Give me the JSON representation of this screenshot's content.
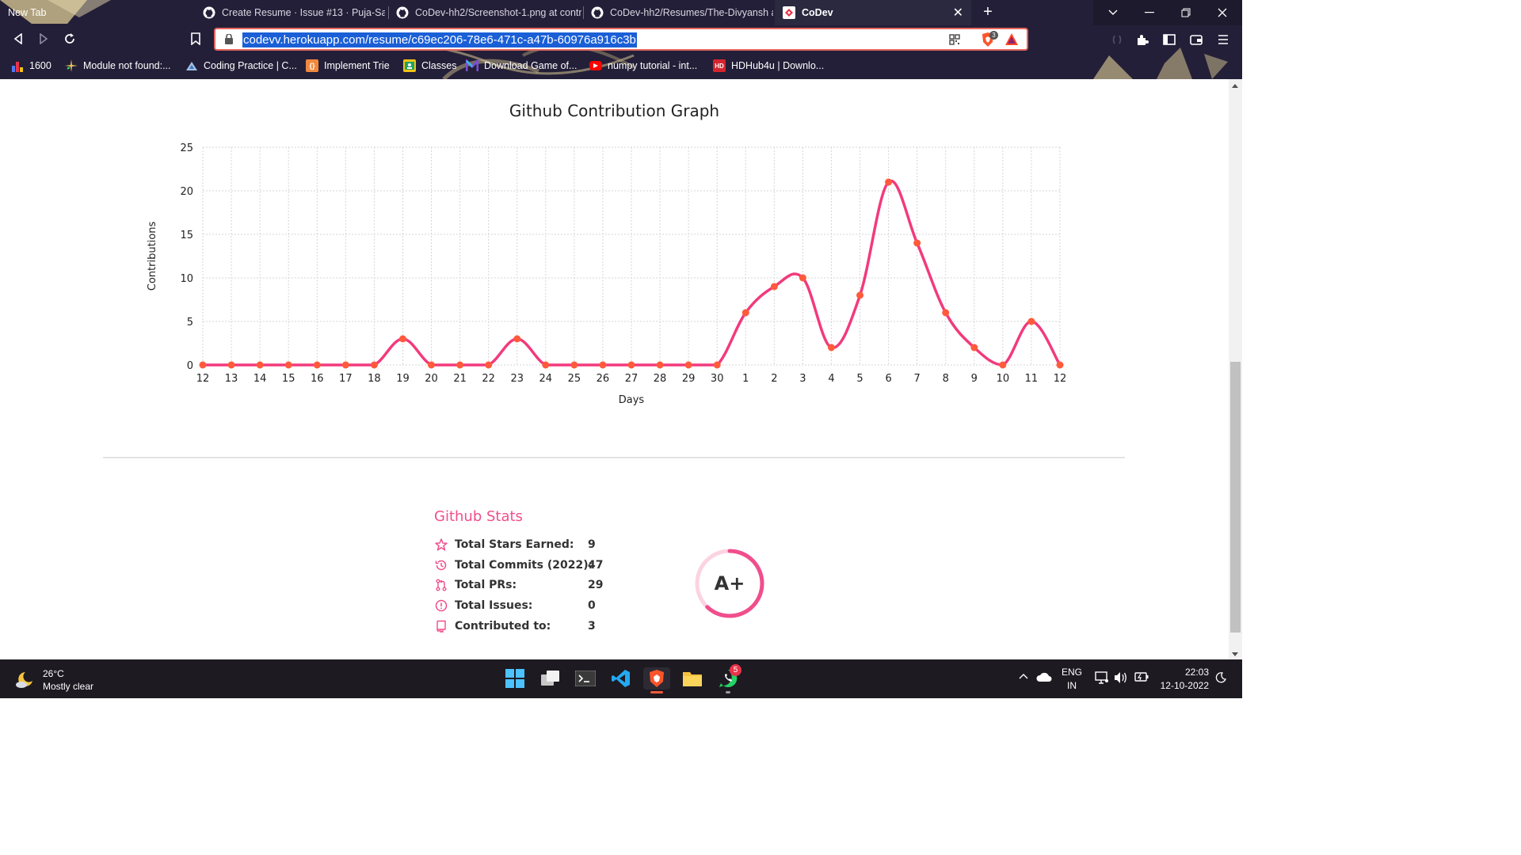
{
  "browser": {
    "tabs": [
      {
        "title": "New Tab"
      },
      {
        "title": "Create Resume · Issue #13 · Puja-Sam"
      },
      {
        "title": "CoDev-hh2/Screenshot-1.png at contr"
      },
      {
        "title": "CoDev-hh2/Resumes/The-Divyansh a"
      },
      {
        "title": "CoDev"
      }
    ],
    "new_tab_label": "+",
    "url": "codevv.herokuapp.com/resume/c69ec206-78e6-471c-a47b-60976a916c3b",
    "brave_shield_count": "3",
    "bookmarks": [
      {
        "label": "1600",
        "color": "#4c7bf2",
        "icon": "bar-chart-icon"
      },
      {
        "label": "Module not found:...",
        "color": "#e7c55a",
        "icon": "sparkle-icon"
      },
      {
        "label": "Coding Practice | C...",
        "color": "#9fc2e8",
        "icon": "triangle-logo-icon"
      },
      {
        "label": "Implement Trie",
        "color": "#f0883e",
        "icon": "code-icon"
      },
      {
        "label": "Classes",
        "color": "#f3c315",
        "icon": "classroom-icon"
      },
      {
        "label": "Download Game of...",
        "color": "#7a4fd6",
        "icon": "m-logo-icon"
      },
      {
        "label": "numpy tutorial - int...",
        "color": "#ff0000",
        "icon": "youtube-icon"
      },
      {
        "label": "HDHub4u | Downlo...",
        "color": "#d6242e",
        "icon": "hd-icon"
      }
    ]
  },
  "chart_data": {
    "type": "line",
    "title": "Github Contribution Graph",
    "xlabel": "Days",
    "ylabel": "Contributions",
    "categories": [
      "12",
      "13",
      "14",
      "15",
      "16",
      "17",
      "18",
      "19",
      "20",
      "21",
      "22",
      "23",
      "24",
      "25",
      "26",
      "27",
      "28",
      "29",
      "30",
      "1",
      "2",
      "3",
      "4",
      "5",
      "6",
      "7",
      "8",
      "9",
      "10",
      "11",
      "12"
    ],
    "values": [
      0,
      0,
      0,
      0,
      0,
      0,
      0,
      3,
      0,
      0,
      0,
      3,
      0,
      0,
      0,
      0,
      0,
      0,
      0,
      6,
      9,
      10,
      2,
      8,
      21,
      14,
      6,
      2,
      0,
      5,
      0
    ],
    "ylim": [
      0,
      25
    ],
    "yticks": [
      "0",
      "5",
      "10",
      "15",
      "20",
      "25"
    ],
    "grid": true,
    "line_color": "#f23a7c",
    "point_color": "#ff5a3c"
  },
  "stats": {
    "title": "Github Stats",
    "rows": [
      {
        "label": "Total Stars Earned:",
        "value": "9",
        "icon": "star-icon"
      },
      {
        "label": "Total Commits (2022):",
        "value": "47",
        "icon": "history-icon"
      },
      {
        "label": "Total PRs:",
        "value": "29",
        "icon": "pull-request-icon"
      },
      {
        "label": "Total Issues:",
        "value": "0",
        "icon": "issue-icon"
      },
      {
        "label": "Contributed to:",
        "value": "3",
        "icon": "repo-icon"
      }
    ],
    "rank": "A+",
    "rank_progress": 0.62,
    "accent": "#f04e8c"
  },
  "taskbar": {
    "temperature": "26°C",
    "weather": "Mostly clear",
    "whatsapp_badge": "5",
    "lang_top": "ENG",
    "lang_bottom": "IN",
    "time": "22:03",
    "date": "12-10-2022"
  }
}
